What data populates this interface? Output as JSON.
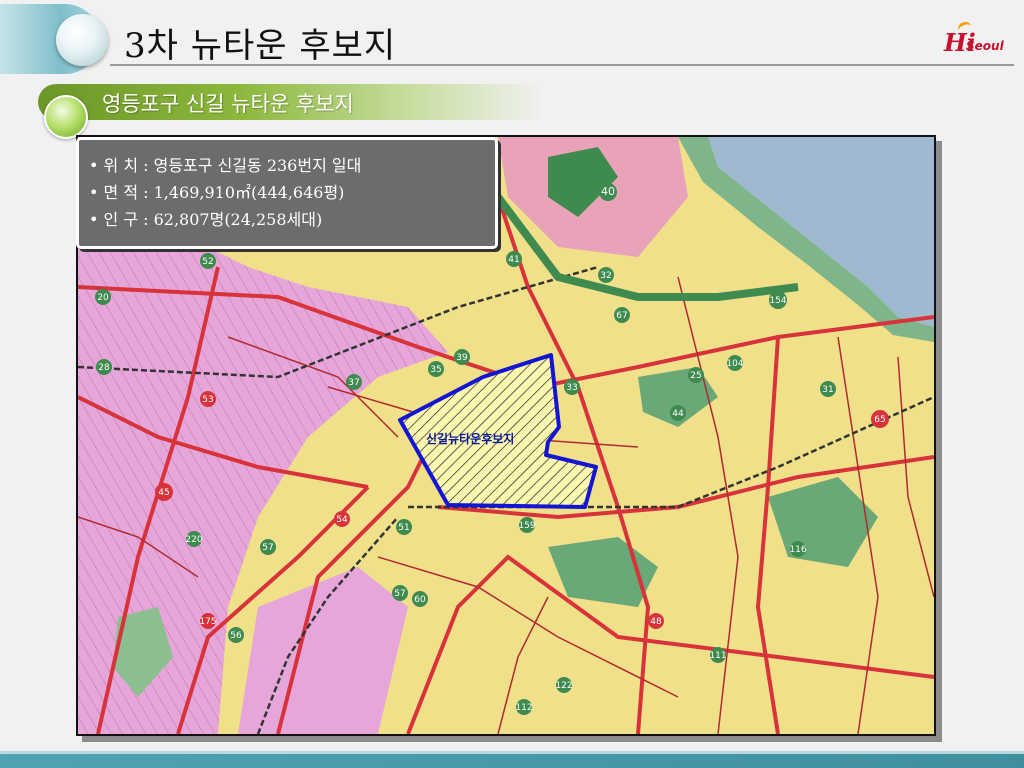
{
  "header": {
    "title": "3차 뉴타운 후보지",
    "logo_hi": "Hi",
    "logo_seoul": "Seoul"
  },
  "section": {
    "title": "영등포구 신길 뉴타운 후보지"
  },
  "info": {
    "location": "• 위 치 : 영등포구 신길동 236번지 일대",
    "area": "• 면 적 : 1,469,910㎡(444,646평)",
    "population": "• 인 구 : 62,807명(24,258세대)"
  },
  "map": {
    "candidate_label": "신길뉴타운후보지",
    "route_numbers": [
      "40",
      "41",
      "32",
      "67",
      "154",
      "52",
      "20",
      "39",
      "35",
      "37",
      "33",
      "44",
      "31",
      "65",
      "25",
      "104",
      "45",
      "57",
      "51",
      "54",
      "159",
      "220",
      "175",
      "56",
      "57",
      "60",
      "116",
      "48",
      "111",
      "122",
      "112",
      "28",
      "53"
    ],
    "colors": {
      "residential": "#efe089",
      "commercial": "#e3a1d6",
      "boundary": "#1414d4",
      "road": "#d8323b",
      "park": "#5fa86a",
      "water": "#9fbad0"
    }
  }
}
